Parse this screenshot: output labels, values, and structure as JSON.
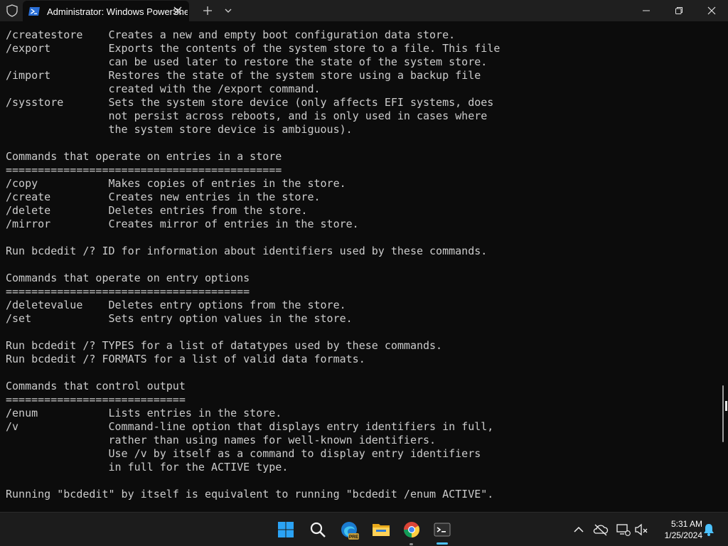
{
  "window": {
    "tab_title": "Administrator: Windows PowerShell"
  },
  "icons": {
    "shield": "shield-icon",
    "tab": "powershell-icon",
    "close_tab": "close-icon",
    "new_tab": "plus-icon",
    "dropdown": "chevron-down-icon",
    "minimize": "minimize-icon",
    "maximize": "restore-icon",
    "close_window": "close-icon"
  },
  "terminal": {
    "lines": [
      "/createstore    Creates a new and empty boot configuration data store.",
      "/export         Exports the contents of the system store to a file. This file",
      "                can be used later to restore the state of the system store.",
      "/import         Restores the state of the system store using a backup file",
      "                created with the /export command.",
      "/sysstore       Sets the system store device (only affects EFI systems, does",
      "                not persist across reboots, and is only used in cases where",
      "                the system store device is ambiguous).",
      "",
      "Commands that operate on entries in a store",
      "===========================================",
      "/copy           Makes copies of entries in the store.",
      "/create         Creates new entries in the store.",
      "/delete         Deletes entries from the store.",
      "/mirror         Creates mirror of entries in the store.",
      "",
      "Run bcdedit /? ID for information about identifiers used by these commands.",
      "",
      "Commands that operate on entry options",
      "======================================",
      "/deletevalue    Deletes entry options from the store.",
      "/set            Sets entry option values in the store.",
      "",
      "Run bcdedit /? TYPES for a list of datatypes used by these commands.",
      "Run bcdedit /? FORMATS for a list of valid data formats.",
      "",
      "Commands that control output",
      "============================",
      "/enum           Lists entries in the store.",
      "/v              Command-line option that displays entry identifiers in full,",
      "                rather than using names for well-known identifiers.",
      "                Use /v by itself as a command to display entry identifiers",
      "                in full for the ACTIVE type.",
      "",
      "Running \"bcdedit\" by itself is equivalent to running \"bcdedit /enum ACTIVE\"."
    ]
  },
  "taskbar": {
    "apps": [
      "start-icon",
      "search-icon",
      "edge-beta-icon",
      "file-explorer-icon",
      "chrome-icon",
      "terminal-icon"
    ],
    "edge_badge": "PRE",
    "tray": [
      "chevron-up-icon",
      "onedrive-offline-icon",
      "network-icon",
      "volume-muted-icon",
      "notification-bell-icon"
    ],
    "time": "5:31 AM",
    "date": "1/25/2024"
  },
  "colors": {
    "terminal_bg": "#0c0c0c",
    "terminal_fg": "#cccccc",
    "titlebar_bg": "#1f1f1f",
    "taskbar_bg": "#1c1c1c",
    "accent": "#4cc2ff"
  }
}
